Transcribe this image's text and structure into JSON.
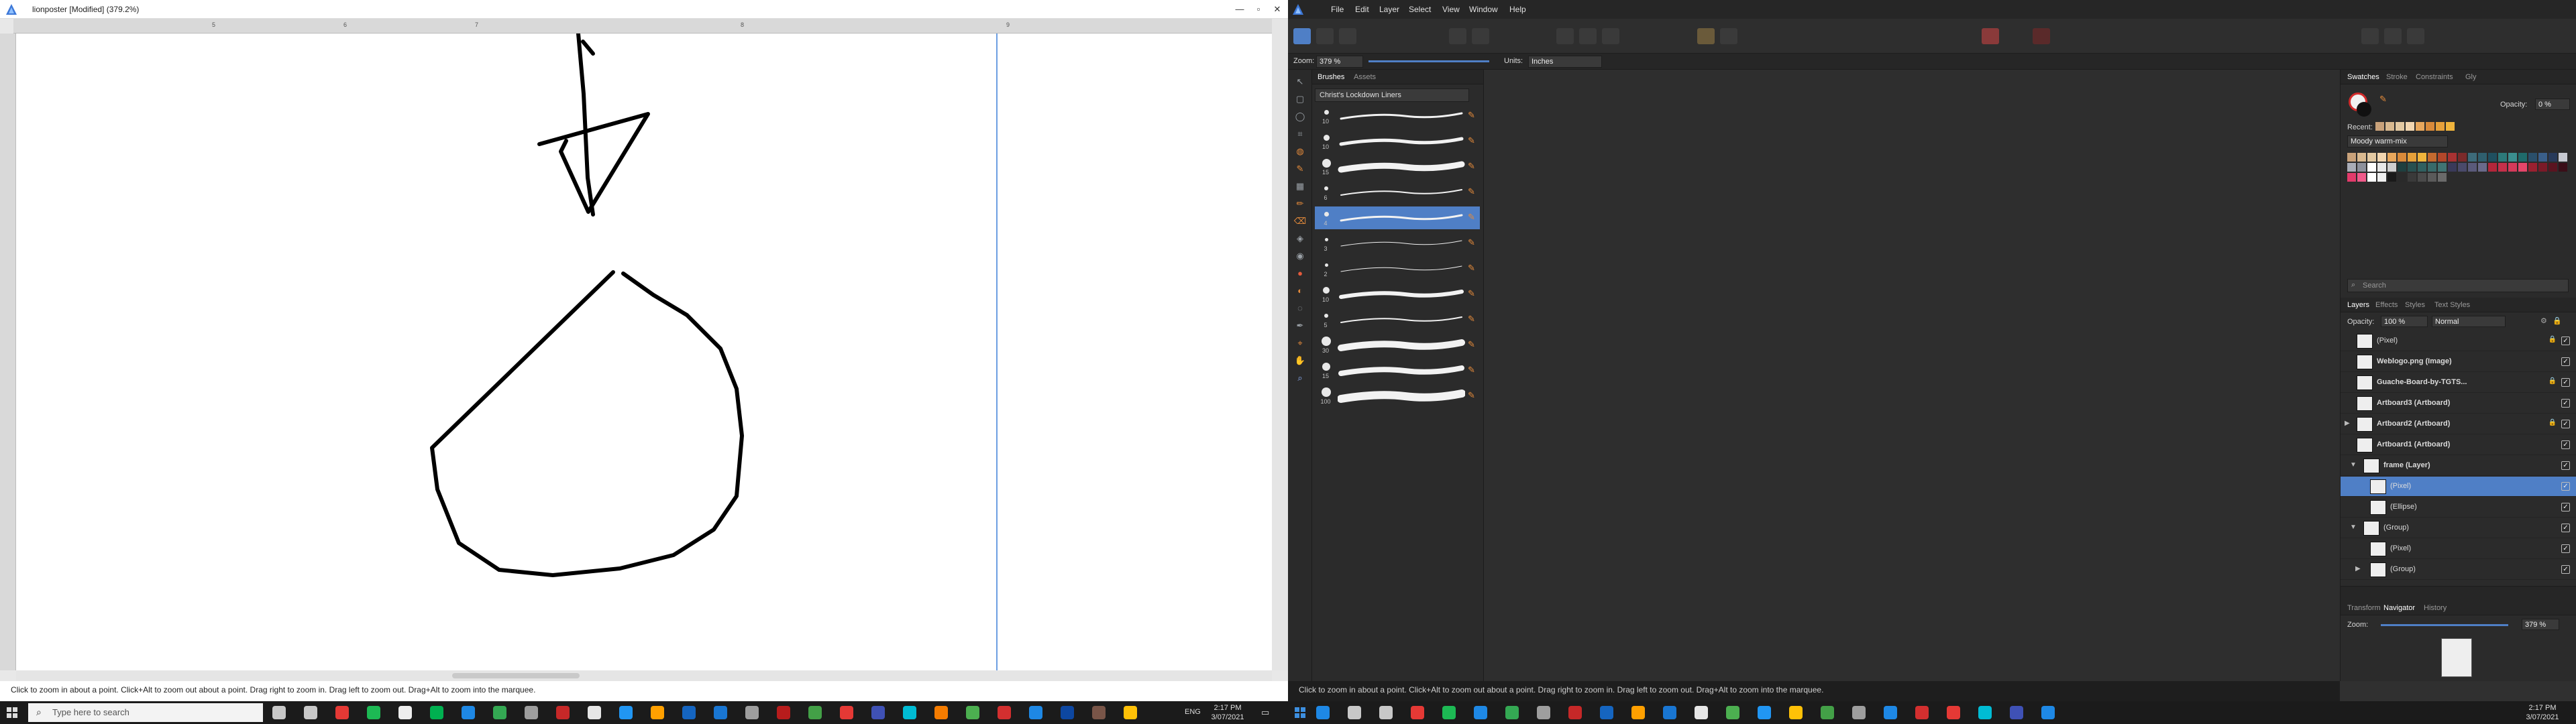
{
  "left_window": {
    "title": "lionposter [Modified] (379.2%)",
    "controls": [
      "—",
      "▫",
      "✕"
    ],
    "ruler_top_ticks": [
      "5",
      "6",
      "7",
      "8",
      "9"
    ],
    "status_text": "Click to zoom in about a point. Click+Alt to zoom out about a point. Drag right to zoom in. Drag left to zoom out. Drag+Alt to zoom into the marquee."
  },
  "right_window": {
    "menu": [
      "File",
      "Edit",
      "Layer",
      "Select",
      "View",
      "Window",
      "Help"
    ],
    "context_bar": {
      "zoom_label": "Zoom:",
      "zoom_value": "379 %",
      "units_label": "Units:",
      "units_value": "Inches"
    },
    "brushes_panel": {
      "tabs": [
        "Brushes",
        "Assets"
      ],
      "category": "Christ's Lockdown Liners",
      "brushes": [
        {
          "size": "10",
          "selected": false
        },
        {
          "size": "10",
          "selected": false
        },
        {
          "size": "15",
          "selected": false
        },
        {
          "size": "6",
          "selected": false
        },
        {
          "size": "4",
          "selected": true
        },
        {
          "size": "3",
          "selected": false
        },
        {
          "size": "2",
          "selected": false
        },
        {
          "size": "10",
          "selected": false
        },
        {
          "size": "5",
          "selected": false
        },
        {
          "size": "30",
          "selected": false
        },
        {
          "size": "15",
          "selected": false
        },
        {
          "size": "100",
          "selected": false
        }
      ]
    },
    "swatches_panel": {
      "tabs": [
        "Swatches",
        "Stroke",
        "Constraints",
        "Gly"
      ],
      "opacity_label": "Opacity:",
      "opacity_value": "0 %",
      "recent_label": "Recent:",
      "palette_name": "Moody warm-mix",
      "colors": [
        "#c9a27a",
        "#d9b98f",
        "#e3c9a2",
        "#f2d6b0",
        "#e8a75c",
        "#d98a3a",
        "#e6a03a",
        "#f0b43c",
        "#c46a2f",
        "#b3472a",
        "#a83232",
        "#7b2a2a",
        "#3d6b7a",
        "#2f5f6e",
        "#1f4f5f",
        "#2c7a7a",
        "#3b8f8f",
        "#1f6b6b",
        "#2a4f6b",
        "#3a5f8a",
        "#283a5a",
        "#c7c9d1",
        "#a9adb7",
        "#8d919c",
        "#ffffff",
        "#e8e8e8",
        "#cfcfcf",
        "#1f3f3f",
        "#285050",
        "#306060",
        "#386a6a",
        "#407474",
        "#3a3a5a",
        "#4a4a6a",
        "#5a5a7a",
        "#6a6a8a",
        "#b3263a",
        "#c4304a",
        "#d43a5a",
        "#e5466a",
        "#9a2030",
        "#7a1a28",
        "#5a1420",
        "#3a0e18",
        "#e23a6a",
        "#f05a8a",
        "#ffffff",
        "#f0f0f0",
        "#1a1a1a",
        "#2a2a2a",
        "#3a3a3a",
        "#4a4a4a",
        "#5a5a5a",
        "#6a6a6a"
      ],
      "search_placeholder": "Search"
    },
    "layers_panel": {
      "tabs": [
        "Layers",
        "Effects",
        "Styles",
        "Text Styles"
      ],
      "opacity_label": "Opacity:",
      "opacity_value": "100 %",
      "blend_mode": "Normal",
      "rows": [
        {
          "name": "(Pixel)",
          "bold": false,
          "selected": false,
          "indent": 0,
          "arrow": "",
          "lock": true
        },
        {
          "name": "Weblogo.png (Image)",
          "bold": true,
          "selected": false,
          "indent": 0,
          "arrow": "",
          "lock": false
        },
        {
          "name": "Guache-Board-by-TGTS...",
          "bold": true,
          "selected": false,
          "indent": 0,
          "arrow": "",
          "lock": true
        },
        {
          "name": "Artboard3 (Artboard)",
          "bold": true,
          "selected": false,
          "indent": 0,
          "arrow": "",
          "lock": false
        },
        {
          "name": "Artboard2 (Artboard)",
          "bold": true,
          "selected": false,
          "indent": 0,
          "arrow": "▶",
          "lock": true
        },
        {
          "name": "Artboard1 (Artboard)",
          "bold": true,
          "selected": false,
          "indent": 0,
          "arrow": "",
          "lock": false
        },
        {
          "name": "frame (Layer)",
          "bold": true,
          "selected": false,
          "indent": 1,
          "arrow": "▼",
          "lock": false
        },
        {
          "name": "(Pixel)",
          "bold": false,
          "selected": true,
          "indent": 2,
          "arrow": "",
          "lock": false
        },
        {
          "name": "(Ellipse)",
          "bold": false,
          "selected": false,
          "indent": 2,
          "arrow": "",
          "lock": false
        },
        {
          "name": "(Group)",
          "bold": false,
          "selected": false,
          "indent": 1,
          "arrow": "▼",
          "lock": false
        },
        {
          "name": "(Pixel)",
          "bold": false,
          "selected": false,
          "indent": 2,
          "arrow": "",
          "lock": false
        },
        {
          "name": "(Group)",
          "bold": false,
          "selected": false,
          "indent": 2,
          "arrow": "▶",
          "lock": false
        }
      ]
    },
    "navigator_panel": {
      "tabs": [
        "Transform",
        "Navigator",
        "History"
      ],
      "zoom_label": "Zoom:",
      "zoom_value": "379 %"
    },
    "status_text": "Click to zoom in about a point. Click+Alt to zoom out about a point. Drag right to zoom in. Drag left to zoom out. Drag+Alt to zoom into the marquee."
  },
  "taskbar": {
    "search_placeholder": "Type here to search",
    "language": "ENG",
    "time": "2:17 PM",
    "date": "3/07/2021",
    "time_right": "2:17 PM",
    "date_right": "3/07/2021",
    "app_colors_left": [
      "#c8c8c8",
      "#c8c8c8",
      "#e53935",
      "#1db954",
      "#eeeeee",
      "#00b050",
      "#1e88e5",
      "#34a853",
      "#9e9e9e",
      "#c62828",
      "#e6e6e6",
      "#2196f3",
      "#ffa000",
      "#1565c0",
      "#1976d2",
      "#9e9e9e",
      "#b71c1c",
      "#43a047",
      "#e53935",
      "#3f51b5",
      "#00bcd4",
      "#f57c00",
      "#4caf50",
      "#d32f2f",
      "#1e88e5",
      "#0d47a1",
      "#795548",
      "#ffc107"
    ],
    "app_colors_right": [
      "#1e88e5",
      "#c8c8c8",
      "#c8c8c8",
      "#e53935",
      "#1db954",
      "#1e88e5",
      "#34a853",
      "#9e9e9e",
      "#c62828",
      "#1565c0",
      "#ffa000",
      "#1976d2",
      "#e6e6e6",
      "#4caf50",
      "#2196f3",
      "#ffc107",
      "#43a047",
      "#9e9e9e",
      "#1e88e5",
      "#d32f2f",
      "#e53935",
      "#00bcd4",
      "#3f51b5",
      "#1e88e5"
    ]
  }
}
